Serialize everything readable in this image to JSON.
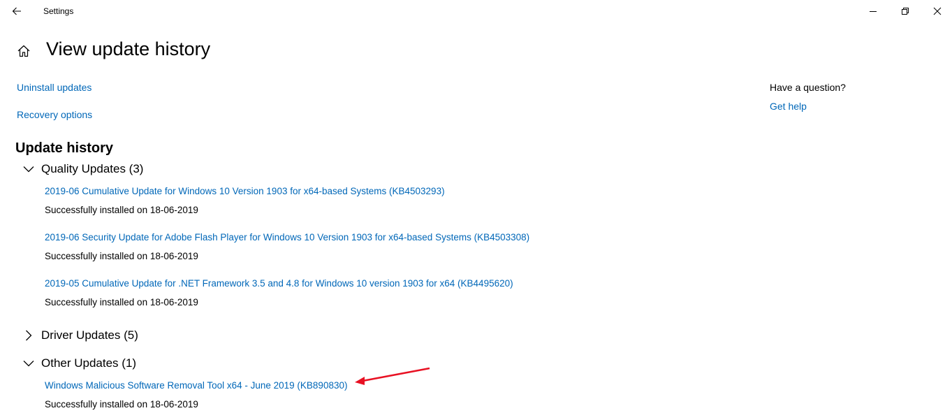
{
  "window": {
    "app_title": "Settings",
    "back_icon": "back-arrow-icon",
    "minimize_icon": "minimize-icon",
    "maximize_icon": "restore-icon",
    "close_icon": "close-icon"
  },
  "header": {
    "home_icon": "home-icon",
    "title": "View update history"
  },
  "links": {
    "uninstall": "Uninstall updates",
    "recovery": "Recovery options"
  },
  "history": {
    "title": "Update history",
    "groups": [
      {
        "label": "Quality Updates (3)",
        "expanded": true,
        "items": [
          {
            "title": "2019-06 Cumulative Update for Windows 10 Version 1903 for x64-based Systems (KB4503293)",
            "status": "Successfully installed on 18-06-2019"
          },
          {
            "title": "2019-06 Security Update for Adobe Flash Player for Windows 10 Version 1903 for x64-based Systems (KB4503308)",
            "status": "Successfully installed on 18-06-2019"
          },
          {
            "title": "2019-05 Cumulative Update for .NET Framework 3.5 and 4.8 for Windows 10 version 1903 for x64 (KB4495620)",
            "status": "Successfully installed on 18-06-2019"
          }
        ]
      },
      {
        "label": "Driver Updates (5)",
        "expanded": false,
        "items": []
      },
      {
        "label": "Other Updates (1)",
        "expanded": true,
        "items": [
          {
            "title": "Windows Malicious Software Removal Tool x64 - June 2019 (KB890830)",
            "status": "Successfully installed on 18-06-2019"
          }
        ]
      }
    ]
  },
  "help": {
    "question": "Have a question?",
    "get_help": "Get help"
  },
  "colors": {
    "link": "#0067b8",
    "annotation_arrow": "#e81123"
  }
}
